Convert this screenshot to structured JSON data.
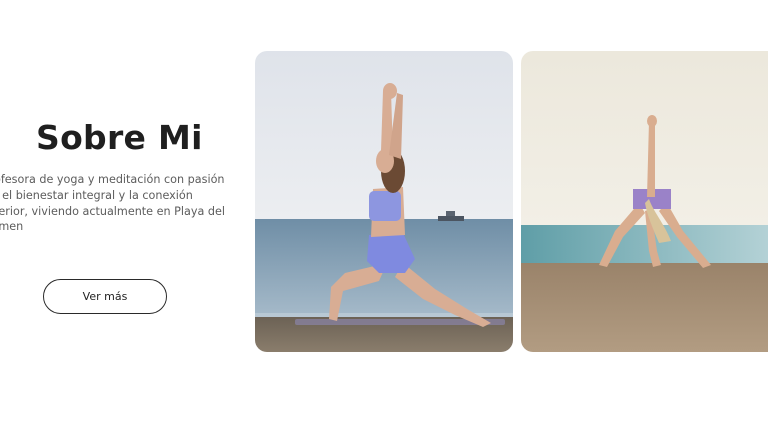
{
  "about": {
    "title": "Sobre Mi",
    "description_lines": [
      "ofesora de yoga y meditación con pasión",
      "r el bienestar integral y la conexión",
      "terior, viviendo actualmente en Playa del",
      "rmen"
    ],
    "button_label": "Ver más"
  },
  "colors": {
    "sky_1": "#e3e6ec",
    "sea": "#7a98ad",
    "sand": "#75695c",
    "outfit": "#8b92dc",
    "sky_2": "#ece9de",
    "sand_2": "#a7927a"
  }
}
